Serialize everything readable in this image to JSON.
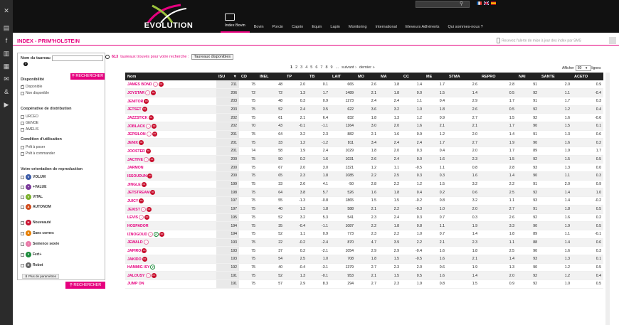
{
  "header": {
    "logo_text": "EVOLUTION",
    "nav": [
      {
        "label": "Index Bovin",
        "active": true
      },
      {
        "label": "Bovin",
        "active": false
      },
      {
        "label": "Porcin",
        "active": false
      },
      {
        "label": "Caprin",
        "active": false
      },
      {
        "label": "Equin",
        "active": false
      },
      {
        "label": "Lapin",
        "active": false
      },
      {
        "label": "Monitoring",
        "active": false
      },
      {
        "label": "International",
        "active": false
      },
      {
        "label": "Eleveurs Adhérents",
        "active": false
      },
      {
        "label": "Qui sommes-nous ?",
        "active": false
      }
    ]
  },
  "page": {
    "title": "INDEX - PRIM'HOLSTEIN",
    "sms_text": "Recevez l'alerte de mise à jour des index par SMS"
  },
  "filters": {
    "name_label": "Nom du taureau",
    "help": "?",
    "search_button": "RECHERCHER",
    "disponibilite_label": "Disponibilité",
    "disponibilite": [
      {
        "label": "Disponible",
        "checked": true
      },
      {
        "label": "Non disponible",
        "checked": false
      }
    ],
    "cooperative_label": "Coopérative de distribution",
    "cooperatives": [
      {
        "label": "URCEO"
      },
      {
        "label": "GENOE"
      },
      {
        "label": "AMELIS"
      }
    ],
    "condition_label": "Condition d'utilisation",
    "conditions": [
      {
        "label": "Prêt à poser"
      },
      {
        "label": "Prêt à commander"
      }
    ],
    "orientation_label": "Votre orientation de reproduction",
    "orientations": [
      {
        "label": "VOLUM",
        "color": "#3a5aa8",
        "glyph": "V"
      },
      {
        "label": "+VALUE",
        "color": "#7a3a9a",
        "glyph": "+"
      },
      {
        "label": "VITAL",
        "color": "#7ab02a",
        "glyph": "V"
      },
      {
        "label": "AUTONOM",
        "color": "#d04a1a",
        "glyph": "A"
      },
      {
        "label": "Nouveauté",
        "color": "#c8102e",
        "glyph": "N"
      },
      {
        "label": "Sans cornes",
        "color": "#e67e00",
        "glyph": "S"
      },
      {
        "label": "Semence sexée",
        "color": "#e87aa8",
        "glyph": "♀"
      },
      {
        "label": "Fert+",
        "color": "#1a8a3a",
        "glyph": "F"
      },
      {
        "label": "Robot",
        "color": "#666666",
        "glyph": "R"
      }
    ],
    "params_label": "Plus de paramètres",
    "search_button_bottom": "RECHERCHER"
  },
  "results": {
    "count": "613",
    "text": "taureaux trouvés pour votre recherche :",
    "tag": "Taureaux disponibles"
  },
  "pager": {
    "pages": [
      "1",
      "2",
      "3",
      "4",
      "5",
      "6",
      "7",
      "8",
      "9",
      "...",
      "suivant ›",
      "dernier »"
    ],
    "show_label": "Afficher",
    "show_value": "80",
    "show_suffix": "lignes"
  },
  "table": {
    "headers": [
      "Nom",
      "ISU",
      "CD",
      "INEL",
      "TP",
      "TB",
      "LAIT",
      "MO",
      "MA",
      "CC",
      "ME",
      "STMA",
      "REPRO",
      "NAI",
      "SANTE",
      "ACETO"
    ],
    "rows": [
      {
        "name": "JAMES BOND",
        "icons": [
          "female",
          "red"
        ],
        "v": [
          "211",
          "75",
          "48",
          "2.0",
          "0.1",
          "665",
          "2.6",
          "1.8",
          "1.4",
          "1.7",
          "2.6",
          "2.8",
          "91",
          "2.0",
          "0.9"
        ]
      },
      {
        "name": "JOYSTAR",
        "icons": [
          "female",
          "red"
        ],
        "v": [
          "206",
          "72",
          "72",
          "1.3",
          "1.7",
          "1489",
          "2.1",
          "1.8",
          "0.0",
          "1.5",
          "1.4",
          "0.5",
          "92",
          "1.1",
          "-0.4"
        ]
      },
      {
        "name": "JENITOR",
        "icons": [
          "red"
        ],
        "v": [
          "203",
          "75",
          "48",
          "0.3",
          "0.9",
          "1273",
          "2.4",
          "2.4",
          "1.1",
          "0.4",
          "2.9",
          "1.7",
          "91",
          "1.7",
          "0.3"
        ]
      },
      {
        "name": "JETSET",
        "icons": [
          "red"
        ],
        "v": [
          "203",
          "75",
          "52",
          "2.4",
          "3.5",
          "622",
          "3.6",
          "3.2",
          "1.0",
          "1.8",
          "2.6",
          "0.5",
          "92",
          "1.2",
          "0.4"
        ]
      },
      {
        "name": "JAZZSTICK",
        "icons": [
          "red"
        ],
        "v": [
          "202",
          "75",
          "61",
          "2.1",
          "6.4",
          "832",
          "1.8",
          "1.3",
          "1.2",
          "0.9",
          "2.7",
          "1.5",
          "92",
          "1.6",
          "-0.6"
        ]
      },
      {
        "name": "JOBLACK",
        "icons": [
          "female",
          "red"
        ],
        "v": [
          "202",
          "70",
          "43",
          "-0.1",
          "-1.1",
          "1164",
          "3.0",
          "2.0",
          "1.6",
          "2.1",
          "2.1",
          "1.7",
          "90",
          "1.5",
          "0.1"
        ]
      },
      {
        "name": "JEPSILON",
        "icons": [
          "female",
          "red"
        ],
        "v": [
          "201",
          "75",
          "64",
          "3.2",
          "2.3",
          "882",
          "2.1",
          "1.6",
          "0.9",
          "1.2",
          "2.0",
          "1.4",
          "91",
          "1.3",
          "0.6"
        ]
      },
      {
        "name": "JENIX",
        "icons": [
          "red"
        ],
        "v": [
          "201",
          "75",
          "33",
          "1.2",
          "-1.2",
          "811",
          "3.4",
          "2.4",
          "2.4",
          "1.7",
          "2.7",
          "1.9",
          "90",
          "1.6",
          "0.2"
        ]
      },
      {
        "name": "JOOSTER",
        "icons": [
          "red"
        ],
        "v": [
          "201",
          "74",
          "58",
          "1.9",
          "2.4",
          "1029",
          "1.8",
          "2.0",
          "0.3",
          "0.4",
          "2.0",
          "1.7",
          "89",
          "1.9",
          "1.7"
        ]
      },
      {
        "name": "JACTIVE",
        "icons": [
          "female",
          "red"
        ],
        "v": [
          "200",
          "75",
          "50",
          "0.2",
          "1.6",
          "1031",
          "2.6",
          "2.4",
          "0.0",
          "1.6",
          "2.3",
          "1.5",
          "92",
          "1.5",
          "0.5"
        ]
      },
      {
        "name": "JARMON",
        "icons": [],
        "v": [
          "200",
          "75",
          "67",
          "2.0",
          "3.0",
          "1321",
          "1.2",
          "1.1",
          "-0.5",
          "1.1",
          "0.8",
          "2.8",
          "93",
          "1.3",
          "0.0"
        ]
      },
      {
        "name": "ISSOUDUN",
        "icons": [
          "red"
        ],
        "v": [
          "200",
          "75",
          "65",
          "2.3",
          "1.8",
          "1085",
          "2.2",
          "2.5",
          "0.3",
          "0.3",
          "1.6",
          "1.4",
          "90",
          "1.1",
          "0.3"
        ]
      },
      {
        "name": "JINGLE",
        "icons": [
          "red"
        ],
        "v": [
          "199",
          "75",
          "33",
          "2.6",
          "4.1",
          "-50",
          "2.8",
          "2.2",
          "1.2",
          "1.5",
          "3.2",
          "2.2",
          "91",
          "2.0",
          "0.9"
        ]
      },
      {
        "name": "JETSTREAM",
        "icons": [
          "red"
        ],
        "v": [
          "198",
          "75",
          "64",
          "3.8",
          "5.7",
          "526",
          "1.6",
          "1.8",
          "0.4",
          "0.2",
          "0.6",
          "2.5",
          "92",
          "1.4",
          "1.0"
        ]
      },
      {
        "name": "JUICY",
        "icons": [
          "red"
        ],
        "v": [
          "197",
          "75",
          "55",
          "-1.3",
          "-0.8",
          "1865",
          "1.5",
          "1.5",
          "-0.2",
          "0.8",
          "3.2",
          "1.1",
          "93",
          "1.4",
          "-0.2"
        ]
      },
      {
        "name": "JEXIST",
        "icons": [
          "female",
          "red"
        ],
        "v": [
          "197",
          "75",
          "40",
          "1.3",
          "1.8",
          "588",
          "2.1",
          "2.2",
          "-0.3",
          "1.0",
          "2.0",
          "2.7",
          "91",
          "1.8",
          "0.5"
        ]
      },
      {
        "name": "LEVIS",
        "icons": [
          "female",
          "red"
        ],
        "v": [
          "195",
          "75",
          "52",
          "3.2",
          "5.3",
          "541",
          "2.3",
          "2.4",
          "0.3",
          "0.7",
          "0.3",
          "2.6",
          "92",
          "1.6",
          "0.2"
        ]
      },
      {
        "name": "HOSPADOR",
        "icons": [],
        "v": [
          "194",
          "75",
          "35",
          "-0.4",
          "-1.1",
          "1087",
          "2.2",
          "1.8",
          "0.8",
          "1.1",
          "1.9",
          "3.3",
          "90",
          "1.9",
          "0.5"
        ]
      },
      {
        "name": "IZNOGOUD",
        "icons": [
          "female",
          "green",
          "red"
        ],
        "v": [
          "194",
          "75",
          "52",
          "1.1",
          "0.9",
          "773",
          "2.3",
          "2.2",
          "1.0",
          "0.7",
          "1.4",
          "1.8",
          "89",
          "1.1",
          "-0.1"
        ]
      },
      {
        "name": "JEWALD",
        "icons": [
          "female"
        ],
        "v": [
          "193",
          "75",
          "22",
          "-0.2",
          "-2.4",
          "870",
          "4.7",
          "3.9",
          "2.2",
          "2.1",
          "2.3",
          "1.1",
          "88",
          "1.4",
          "0.6"
        ]
      },
      {
        "name": "JAPIRO",
        "icons": [
          "red"
        ],
        "v": [
          "193",
          "75",
          "37",
          "0.2",
          "-2.1",
          "1054",
          "2.9",
          "2.9",
          "-0.4",
          "1.6",
          "1.8",
          "2.5",
          "90",
          "1.6",
          "0.3"
        ]
      },
      {
        "name": "JAKIDO",
        "icons": [
          "red"
        ],
        "v": [
          "193",
          "75",
          "54",
          "2.5",
          "1.0",
          "708",
          "1.8",
          "1.5",
          "-0.5",
          "1.6",
          "2.1",
          "1.4",
          "93",
          "1.3",
          "0.1"
        ]
      },
      {
        "name": "HAMMIG ISY",
        "icons": [
          "green"
        ],
        "v": [
          "192",
          "75",
          "40",
          "-0.4",
          "-3.1",
          "1379",
          "2.7",
          "2.3",
          "2.0",
          "0.6",
          "1.9",
          "1.3",
          "90",
          "1.2",
          "0.5"
        ]
      },
      {
        "name": "JALOUSY",
        "icons": [
          "female",
          "red"
        ],
        "v": [
          "191",
          "75",
          "52",
          "1.3",
          "-0.1",
          "953",
          "2.1",
          "1.5",
          "0.5",
          "1.6",
          "1.4",
          "2.0",
          "92",
          "1.2",
          "0.4"
        ]
      },
      {
        "name": "JUMP ON",
        "icons": [],
        "v": [
          "191",
          "75",
          "57",
          "2.9",
          "8.3",
          "294",
          "2.7",
          "2.3",
          "1.9",
          "0.8",
          "1.5",
          "0.9",
          "92",
          "1.0",
          "0.5"
        ]
      }
    ]
  }
}
